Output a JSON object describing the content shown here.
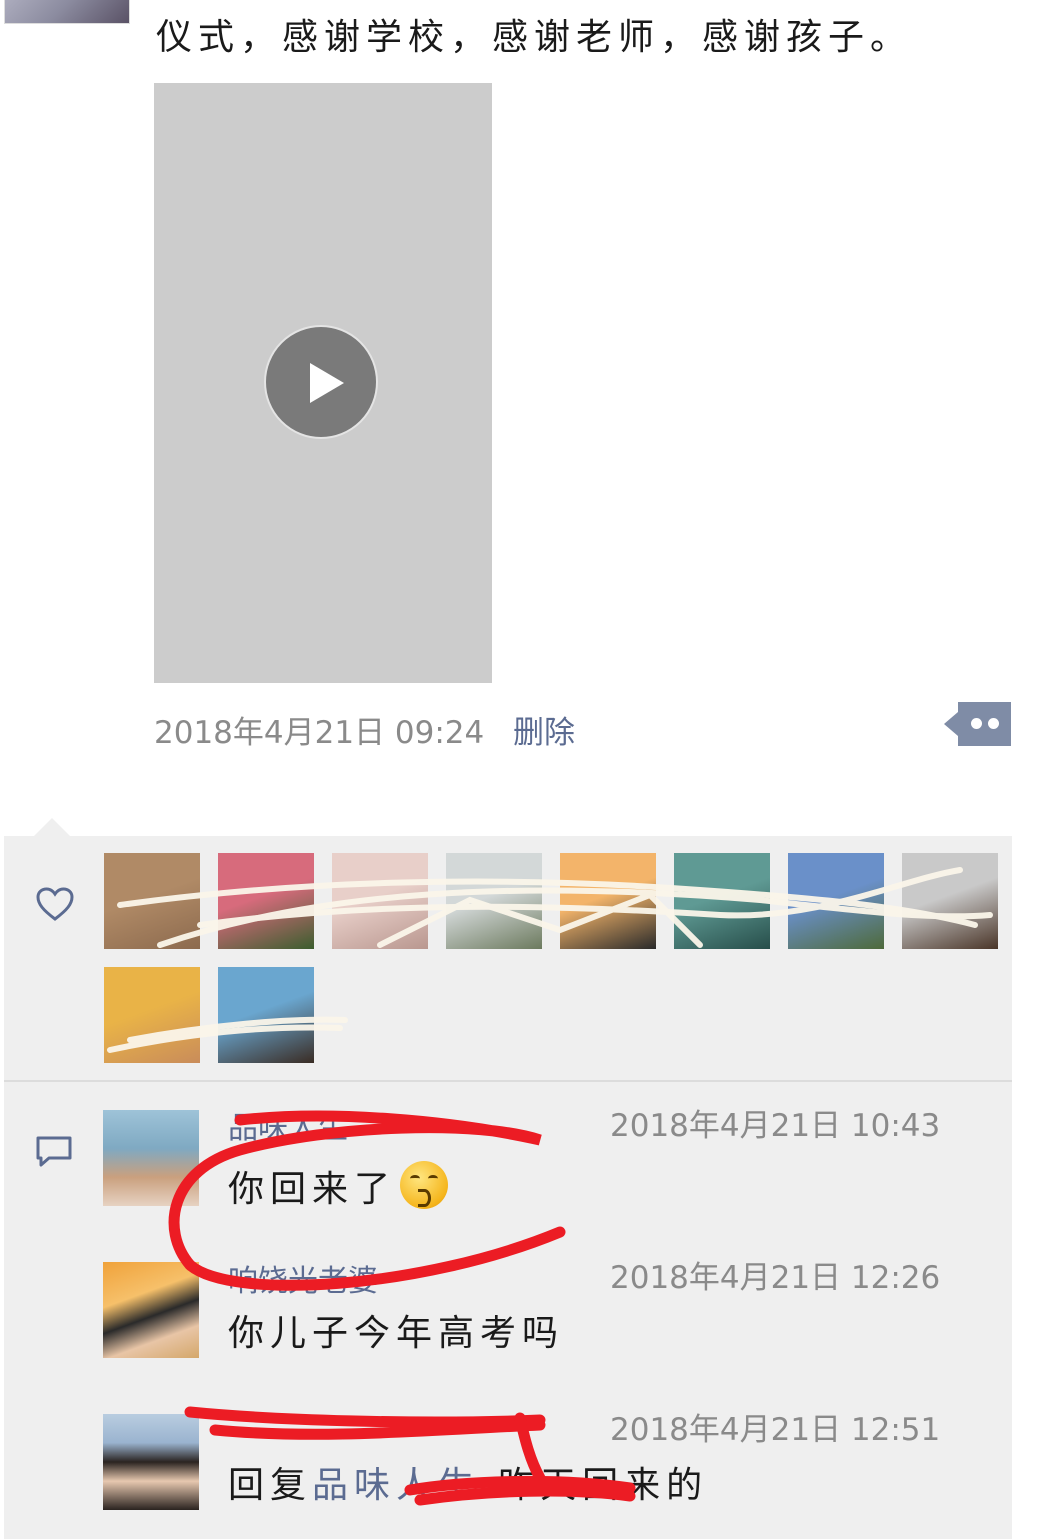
{
  "post": {
    "text_line_top": "　　　　　　　　",
    "text_line": "仪式，感谢学校，感谢老师，感谢孩子。",
    "timestamp": "2018年4月21日  09:24",
    "delete_label": "删除"
  },
  "likes": {
    "icon": "heart-outline-icon",
    "avatars": [
      {
        "colors": [
          "#b08a66",
          "#8c6a4e"
        ]
      },
      {
        "colors": [
          "#d76b7c",
          "#3b5e2e"
        ]
      },
      {
        "colors": [
          "#e8cfc9",
          "#b9978f"
        ]
      },
      {
        "colors": [
          "#d3d8d8",
          "#6c7a5e"
        ]
      },
      {
        "colors": [
          "#f3b46a",
          "#2a2a2a"
        ]
      },
      {
        "colors": [
          "#5f9a94",
          "#274e4a"
        ]
      },
      {
        "colors": [
          "#6a90c9",
          "#4e6a3a"
        ]
      },
      {
        "colors": [
          "#c9c9c9",
          "#4a3528"
        ]
      },
      {
        "colors": [
          "#e9b347",
          "#c98c5a"
        ]
      },
      {
        "colors": [
          "#6aa6cf",
          "#3a2c24"
        ]
      }
    ]
  },
  "comments": {
    "icon": "comment-bubble-icon",
    "items": [
      {
        "name": "品味人生",
        "time": "2018年4月21日  10:43",
        "text": "你回来了",
        "emoji": "kissing-face-emoji",
        "colors": [
          "#7fa9c2",
          "#caa07e"
        ]
      },
      {
        "name": "响饶光老婆",
        "time": "2018年4月21日  12:26",
        "text": "你儿子今年高考吗",
        "colors": [
          "#f0a23a",
          "#2a2a2a"
        ]
      },
      {
        "name": "",
        "time": "2018年4月21日  12:51",
        "reply_prefix": "回复",
        "reply_name": "品味人生",
        "text": "昨天回来的",
        "colors": [
          "#9ab3cf",
          "#2a2320"
        ]
      }
    ]
  }
}
